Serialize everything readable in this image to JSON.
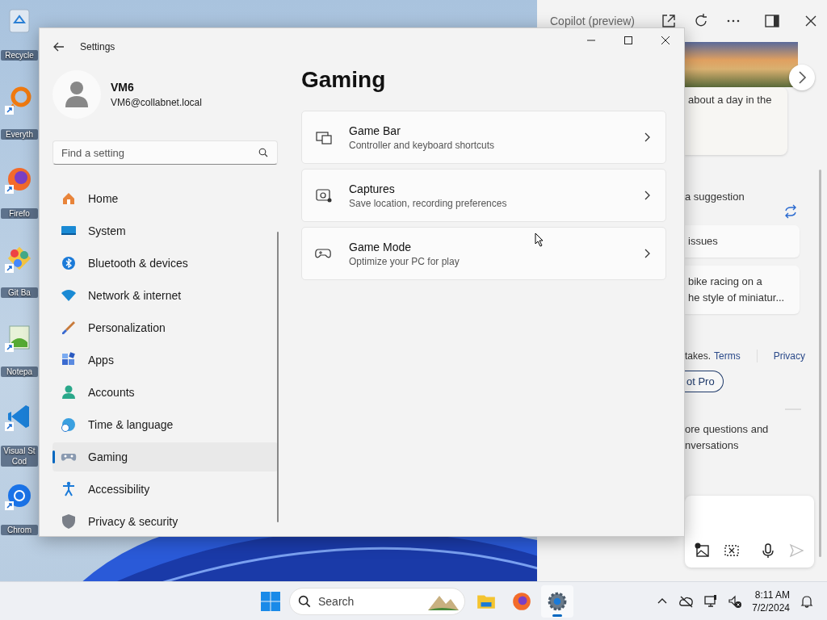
{
  "desktop": {
    "icons": [
      {
        "label": "Recycle",
        "kind": "recycle-bin",
        "shortcut": false
      },
      {
        "label": "Everyth",
        "kind": "search-tool",
        "shortcut": true
      },
      {
        "label": "Firefo",
        "kind": "firefox",
        "shortcut": true
      },
      {
        "label": "Git Ba",
        "kind": "git",
        "shortcut": true
      },
      {
        "label": "Notepa",
        "kind": "notepad",
        "shortcut": true
      },
      {
        "label": "Visual St Cod",
        "kind": "vscode",
        "shortcut": true
      },
      {
        "label": "Chrom",
        "kind": "chrome",
        "shortcut": true
      }
    ]
  },
  "copilot": {
    "title": "Copilot (preview)",
    "card_text": "about a day in the",
    "suggestion_heading": "a suggestion",
    "suggestions": [
      {
        "lines": [
          "issues"
        ]
      },
      {
        "lines": [
          "bike racing on a",
          "he style of miniatur..."
        ]
      }
    ],
    "disclaimer": "takes.",
    "links": [
      "Terms",
      "Privacy"
    ],
    "pro_button": "ot Pro",
    "history_text": [
      "ore questions and",
      "nversations"
    ]
  },
  "settings": {
    "window": {
      "title": "Settings"
    },
    "user": {
      "name": "VM6",
      "email": "VM6@collabnet.local"
    },
    "search": {
      "placeholder": "Find a setting"
    },
    "nav": [
      {
        "label": "Home",
        "kind": "home",
        "selected": false
      },
      {
        "label": "System",
        "kind": "system",
        "selected": false
      },
      {
        "label": "Bluetooth & devices",
        "kind": "bluetooth",
        "selected": false
      },
      {
        "label": "Network & internet",
        "kind": "network",
        "selected": false
      },
      {
        "label": "Personalization",
        "kind": "brush",
        "selected": false
      },
      {
        "label": "Apps",
        "kind": "apps",
        "selected": false
      },
      {
        "label": "Accounts",
        "kind": "accounts",
        "selected": false
      },
      {
        "label": "Time & language",
        "kind": "time",
        "selected": false
      },
      {
        "label": "Gaming",
        "kind": "gaming",
        "selected": true
      },
      {
        "label": "Accessibility",
        "kind": "accessibility",
        "selected": false
      },
      {
        "label": "Privacy & security",
        "kind": "privacy",
        "selected": false
      }
    ],
    "page": {
      "title": "Gaming",
      "cards": [
        {
          "title": "Game Bar",
          "subtitle": "Controller and keyboard shortcuts",
          "kind": "gamebar"
        },
        {
          "title": "Captures",
          "subtitle": "Save location, recording preferences",
          "kind": "captures"
        },
        {
          "title": "Game Mode",
          "subtitle": "Optimize your PC for play",
          "kind": "gamemode"
        }
      ]
    }
  },
  "taskbar": {
    "search_placeholder": "Search",
    "apps": [
      {
        "kind": "explorer",
        "active": false
      },
      {
        "kind": "firefox",
        "active": false
      },
      {
        "kind": "settings",
        "active": true
      }
    ],
    "time": "8:11 AM",
    "date": "7/2/2024"
  }
}
